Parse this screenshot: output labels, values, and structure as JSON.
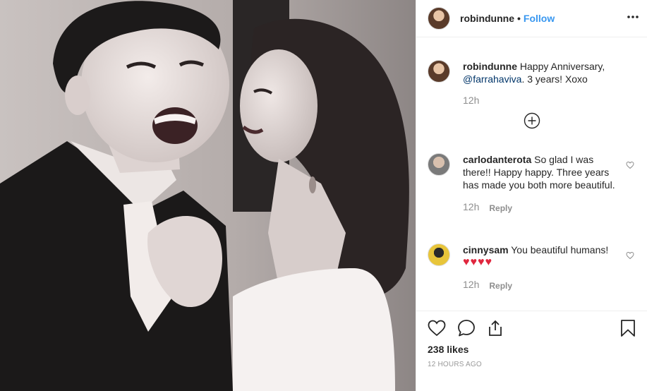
{
  "post": {
    "username": "robindunne",
    "separator": "•",
    "follow_label": "Follow",
    "more_icon": "more-options-icon"
  },
  "caption": {
    "username": "robindunne",
    "text_before": "Happy Anniversary,",
    "mention": "@farrahaviva",
    "text_after": ". 3 years! Xoxo",
    "time": "12h"
  },
  "comments": [
    {
      "username": "carlodanterota",
      "text": "So glad I was there!! Happy happy. Three years has made you both more beautiful.",
      "time": "12h",
      "reply_label": "Reply"
    },
    {
      "username": "cinnysam",
      "text": "You beautiful humans!",
      "emoji": "♥♥♥♥",
      "time": "12h",
      "reply_label": "Reply"
    }
  ],
  "footer": {
    "likes": "238 likes",
    "ago": "12 HOURS AGO"
  },
  "colors": {
    "follow": "#3897f0",
    "hearts": "#e0263e",
    "border": "#efefef",
    "muted": "#8e8e8e"
  }
}
